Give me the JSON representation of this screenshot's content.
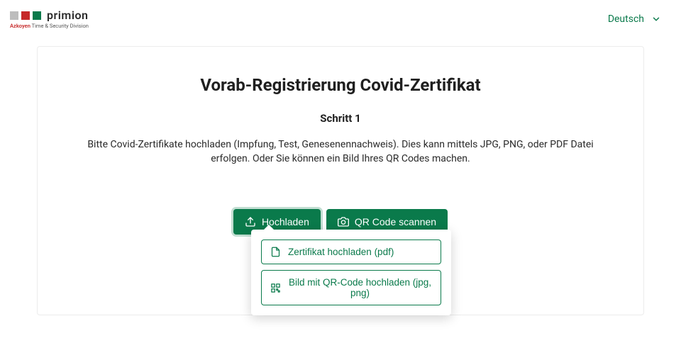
{
  "header": {
    "logo_text": "primion",
    "logo_sub_red": "Azkoyen",
    "logo_sub_rest": " Time & Security Division",
    "language_label": "Deutsch"
  },
  "main": {
    "title": "Vorab-Registrierung Covid-Zertifikat",
    "step_label": "Schritt 1",
    "description": "Bitte Covid-Zertifikate hochladen (Impfung, Test, Genesenennachweis). Dies kann mittels JPG, PNG, oder PDF Datei erfolgen. Oder Sie können ein Bild Ihres QR Codes machen.",
    "upload_button": "Hochladen",
    "scan_button": "QR Code scannen"
  },
  "popover": {
    "option_pdf": "Zertifikat hochladen (pdf)",
    "option_qr": "Bild mit QR-Code hochladen (jpg, png)"
  }
}
